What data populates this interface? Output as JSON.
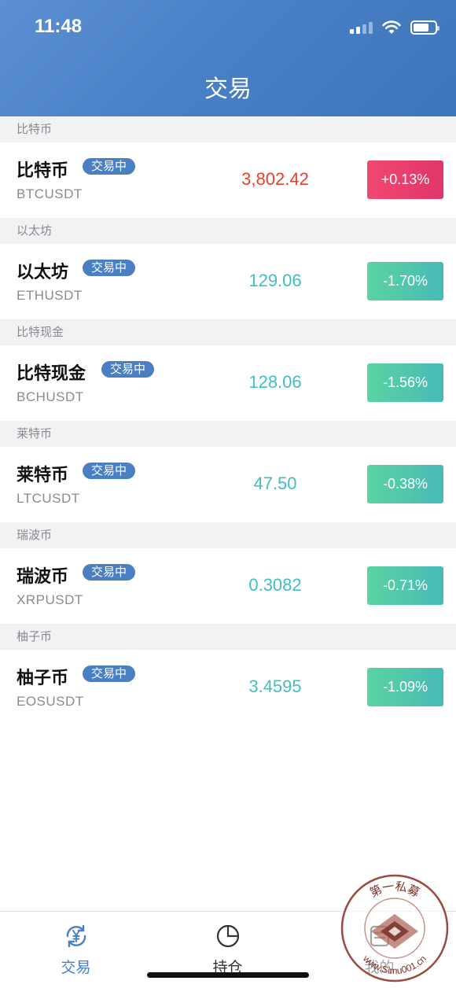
{
  "status_bar": {
    "time": "11:48"
  },
  "header": {
    "title": "交易"
  },
  "colors": {
    "accent": "#4a7fc3",
    "up": "#e8402c",
    "down": "#3fbfc4"
  },
  "assets": [
    {
      "group": "比特币",
      "name": "比特币",
      "badge": "交易中",
      "symbol": "BTCUSDT",
      "price": "3,802.42",
      "change": "+0.13%",
      "direction": "up"
    },
    {
      "group": "以太坊",
      "name": "以太坊",
      "badge": "交易中",
      "symbol": "ETHUSDT",
      "price": "129.06",
      "change": "-1.70%",
      "direction": "down"
    },
    {
      "group": "比特现金",
      "name": "比特现金",
      "badge": "交易中",
      "symbol": "BCHUSDT",
      "price": "128.06",
      "change": "-1.56%",
      "direction": "down"
    },
    {
      "group": "莱特币",
      "name": "莱特币",
      "badge": "交易中",
      "symbol": "LTCUSDT",
      "price": "47.50",
      "change": "-0.38%",
      "direction": "down"
    },
    {
      "group": "瑞波币",
      "name": "瑞波币",
      "badge": "交易中",
      "symbol": "XRPUSDT",
      "price": "0.3082",
      "change": "-0.71%",
      "direction": "down"
    },
    {
      "group": "柚子币",
      "name": "柚子币",
      "badge": "交易中",
      "symbol": "EOSUSDT",
      "price": "3.4595",
      "change": "-1.09%",
      "direction": "down"
    }
  ],
  "tabbar": {
    "tabs": [
      {
        "label": "交易",
        "icon": "yen-exchange-icon",
        "active": true
      },
      {
        "label": "持仓",
        "icon": "pie-chart-icon",
        "active": false
      },
      {
        "label": "我的",
        "icon": "profile-icon",
        "active": false
      }
    ]
  },
  "watermark": {
    "text_top": "第一私募",
    "text_bottom": "www.Simu001.cn"
  }
}
